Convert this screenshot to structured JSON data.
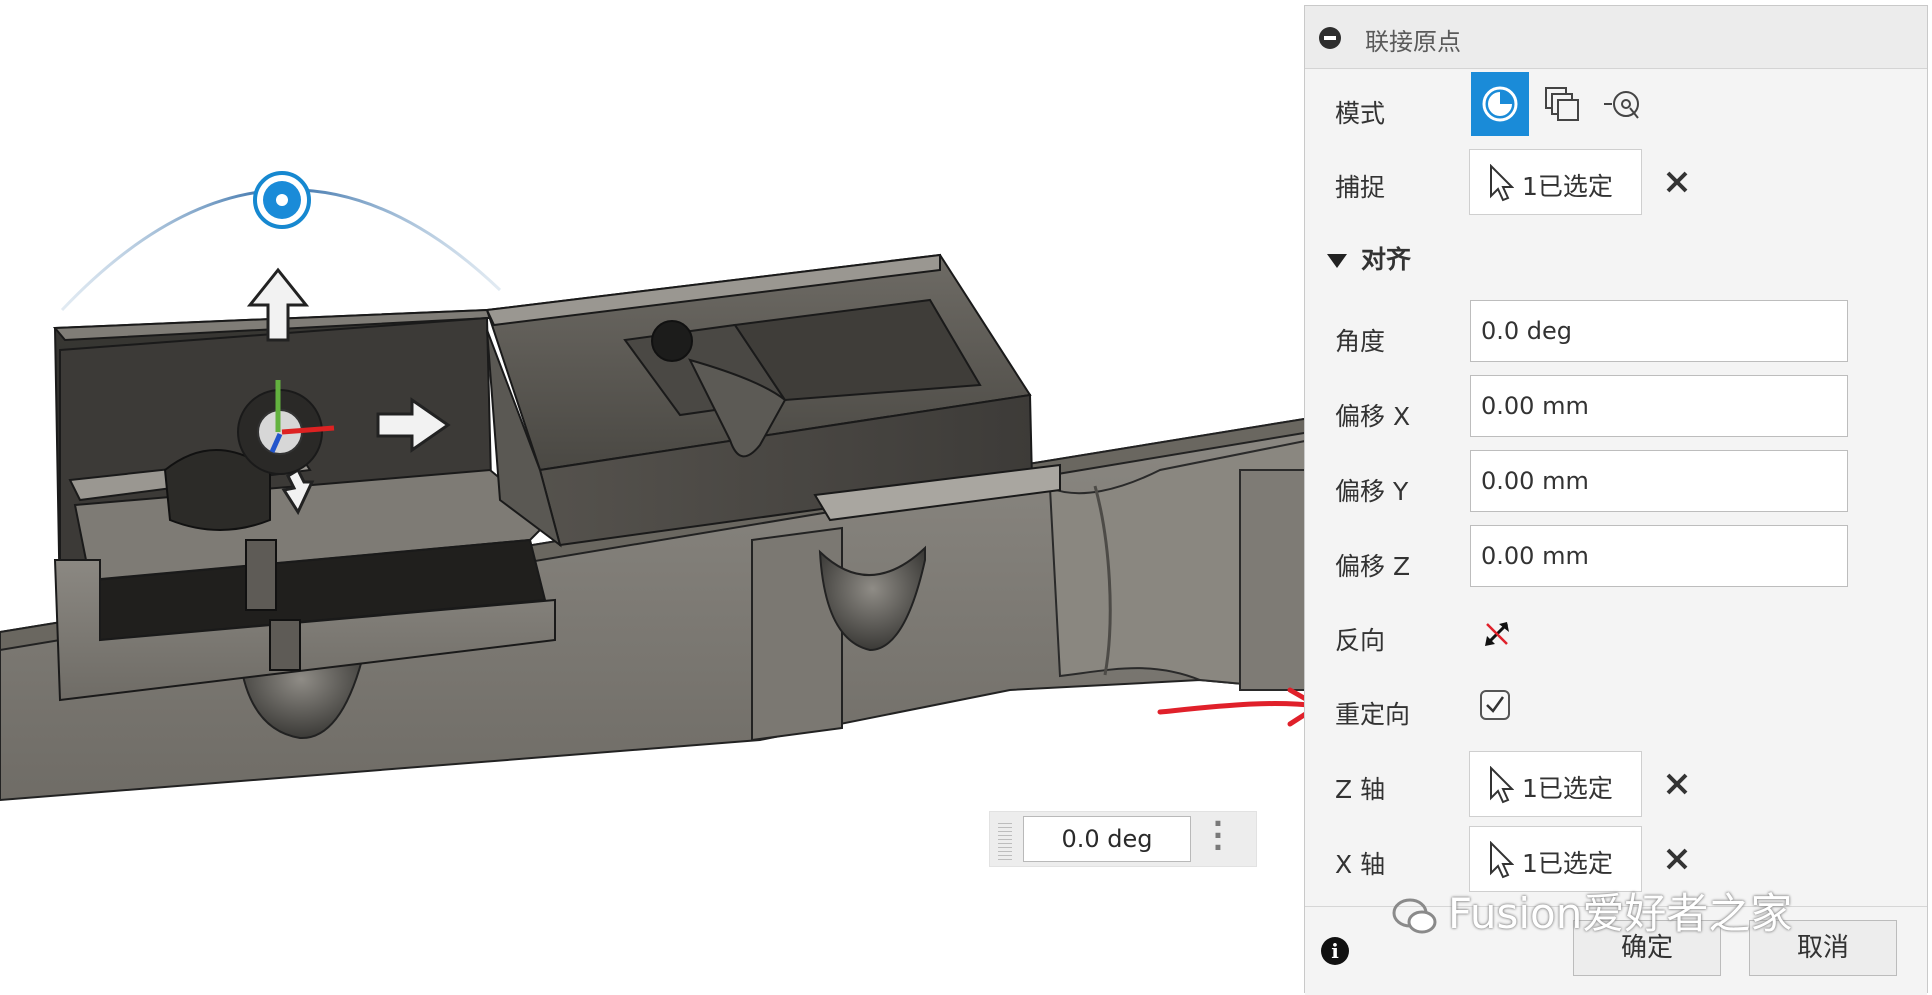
{
  "viewport": {
    "angle_input_value": "0.0 deg"
  },
  "dialog": {
    "title": "联接原点",
    "mode_label": "模式",
    "snap_label": "捕捉",
    "snap_selection": "1已选定",
    "align_section": "对齐",
    "angle_label": "角度",
    "angle_value": "0.0 deg",
    "offset_x_label": "偏移 X",
    "offset_x_value": "0.00 mm",
    "offset_y_label": "偏移 Y",
    "offset_y_value": "0.00 mm",
    "offset_z_label": "偏移 Z",
    "offset_z_value": "0.00 mm",
    "flip_label": "反向",
    "reorient_label": "重定向",
    "reorient_checked": true,
    "z_axis_label": "Z 轴",
    "z_axis_selection": "1已选定",
    "x_axis_label": "X 轴",
    "x_axis_selection": "1已选定",
    "ok_label": "确定",
    "cancel_label": "取消"
  },
  "watermark": "Fusion爱好者之家",
  "colors": {
    "accent": "#1a8bd8",
    "annotation_arrow": "#e0202a"
  }
}
